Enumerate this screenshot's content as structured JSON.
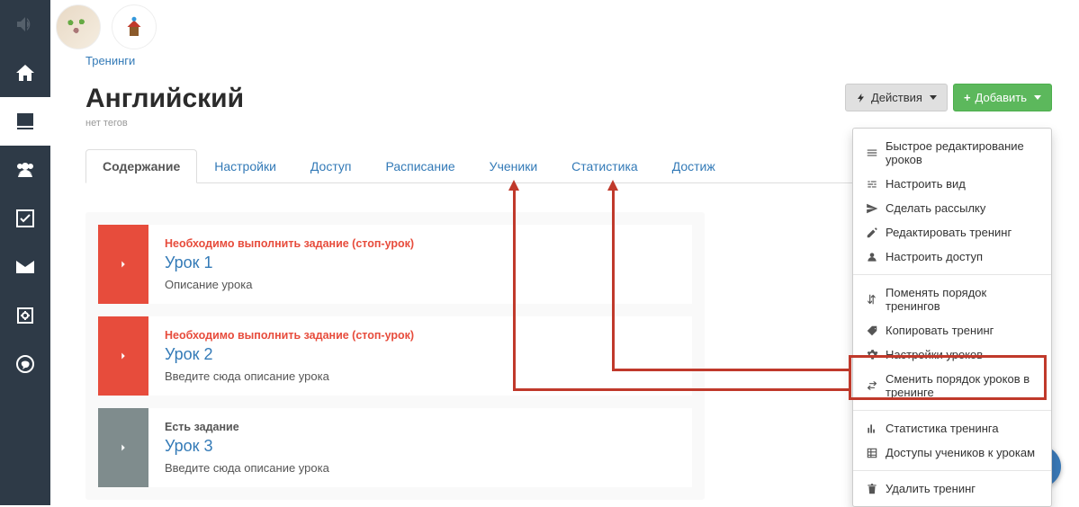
{
  "breadcrumb": "Тренинги",
  "title": "Английский",
  "subtitle": "нет тегов",
  "actions_btn": "Действия",
  "add_btn": "Добавить",
  "tabs": [
    "Содержание",
    "Настройки",
    "Доступ",
    "Расписание",
    "Ученики",
    "Статистика",
    "Достиж"
  ],
  "lessons": [
    {
      "tag": "Необходимо выполнить задание (стоп-урок)",
      "title": "Урок 1",
      "desc": "Описание урока",
      "red": true
    },
    {
      "tag": "Необходимо выполнить задание (стоп-урок)",
      "title": "Урок 2",
      "desc": "Введите сюда описание урока",
      "red": true
    },
    {
      "tag": "Есть задание",
      "title": "Урок 3",
      "desc": "Введите сюда описание урока",
      "red": false
    }
  ],
  "menu": {
    "g1": [
      "Быстрое редактирование уроков",
      "Настроить вид",
      "Сделать рассылку",
      "Редактировать тренинг",
      "Настроить доступ"
    ],
    "g2": [
      "Поменять порядок тренингов",
      "Копировать тренинг",
      "Настройки уроков",
      "Сменить порядок уроков в тренинге"
    ],
    "g3": [
      "Статистика тренинга",
      "Доступы учеников к урокам"
    ],
    "g4": [
      "Удалить тренинг"
    ]
  }
}
